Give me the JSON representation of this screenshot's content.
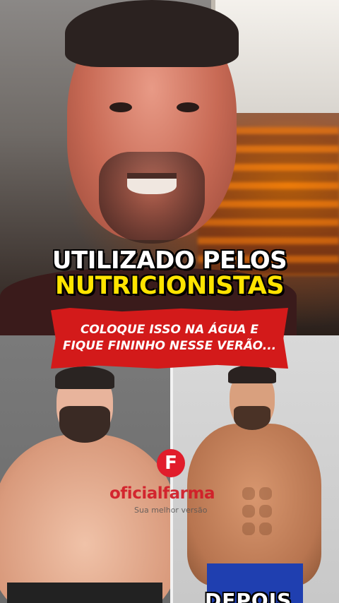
{
  "headline": {
    "line1": "UTILIZADO PELOS",
    "line2": "NUTRICIONISTAS"
  },
  "banner": {
    "line1": "COLOQUE ISSO NA ÁGUA E",
    "line2": "FIQUE FININHO NESSE VERÃO..."
  },
  "comparison": {
    "after_label": "DEPOIS"
  },
  "watermark": {
    "icon_letter": "F",
    "brand": "oficialfarma",
    "tagline": "Sua melhor versão"
  },
  "colors": {
    "banner_red": "#d31a1a",
    "headline_yellow": "#ffe400",
    "brand_red": "#d21b27",
    "shorts_blue": "#1f3fb0"
  }
}
